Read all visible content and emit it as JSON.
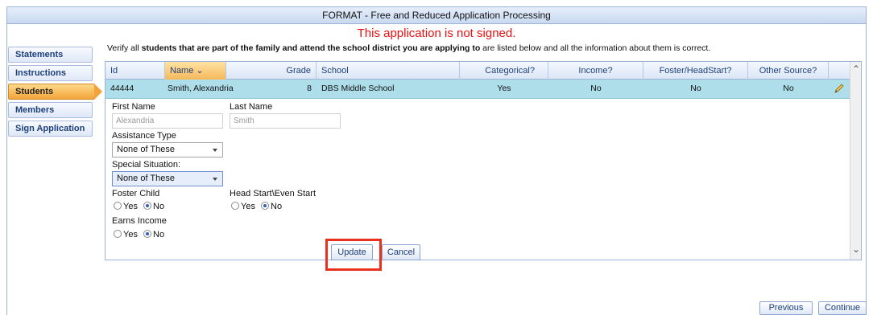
{
  "window": {
    "title": "FORMAT - Free and Reduced Application Processing"
  },
  "warning": "This application is not signed.",
  "instructions": {
    "pre": "Verify all ",
    "bold": "students that are part of the family and attend the school district you are applying to",
    "post": " are listed below and all the information about them is correct."
  },
  "sidebar": {
    "items": [
      {
        "label": "Statements"
      },
      {
        "label": "Instructions"
      },
      {
        "label": "Students"
      },
      {
        "label": "Members"
      },
      {
        "label": "Sign Application"
      }
    ],
    "active": "Students"
  },
  "grid": {
    "columns": [
      "Id",
      "Name",
      "Grade",
      "School",
      "Categorical?",
      "Income?",
      "Foster/HeadStart?",
      "Other Source?"
    ],
    "sort_indicator": "⌄",
    "rows": [
      {
        "id": "44444",
        "name": "Smith, Alexandria",
        "grade": "8",
        "school": "DBS Middle School",
        "categorical": "Yes",
        "income": "No",
        "foster": "No",
        "other": "No"
      }
    ]
  },
  "form": {
    "first_name_label": "First Name",
    "first_name_value": "Alexandria",
    "last_name_label": "Last Name",
    "last_name_value": "Smith",
    "assistance_label": "Assistance Type",
    "assistance_value": "None of These",
    "special_label": "Special Situation:",
    "special_value": "None of These",
    "foster_label": "Foster Child",
    "headstart_label": "Head Start\\Even Start",
    "earns_label": "Earns Income",
    "yes": "Yes",
    "no": "No",
    "update_label": "Update",
    "cancel_label": "Cancel"
  },
  "nav": {
    "previous_label": "Previous",
    "continue_label": "Continue"
  },
  "colors": {
    "warning": "#e81010",
    "highlight": "#e8321f",
    "selected_row": "#aedeea",
    "active_tab": "#f2a43a"
  }
}
